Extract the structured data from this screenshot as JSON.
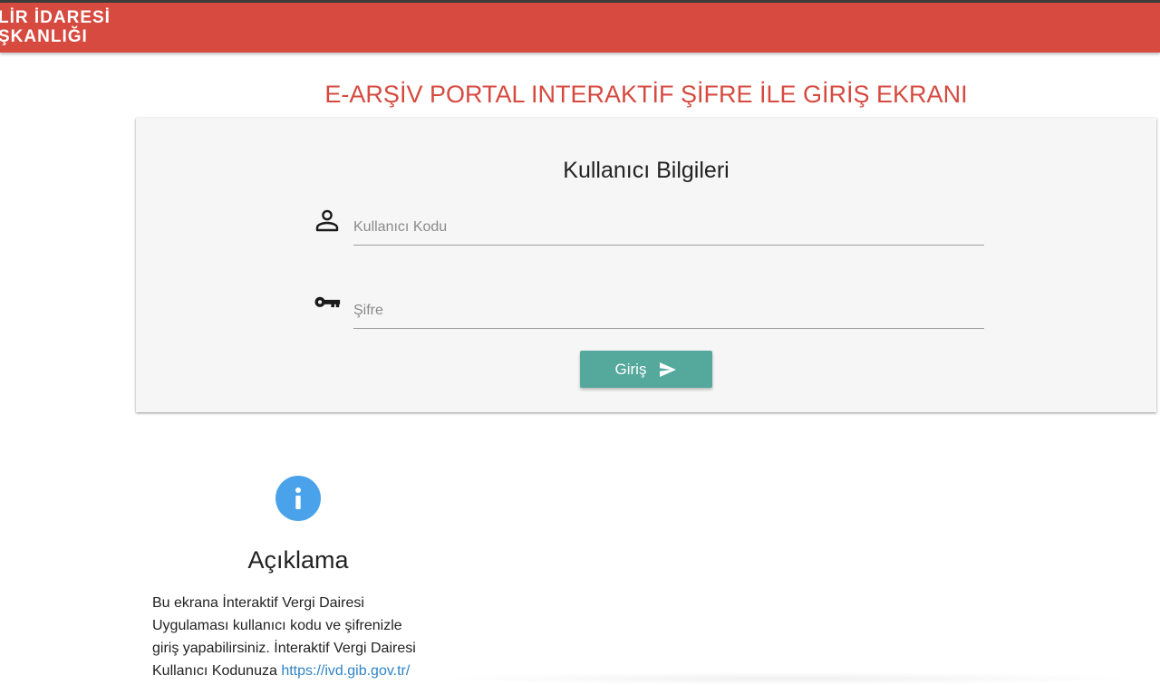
{
  "header": {
    "brand_line1": "LİR İDARESİ",
    "brand_line2": "ŞKANLIĞI",
    "bar_color": "#d64a40"
  },
  "page": {
    "title": "E-ARŞİV PORTAL INTERAKTİF ŞİFRE İLE GİRİŞ EKRANI"
  },
  "login": {
    "card_title": "Kullanıcı Bilgileri",
    "user_icon": "person-icon",
    "username_placeholder": "Kullanıcı Kodu",
    "username_value": "",
    "password_icon": "key-icon",
    "password_placeholder": "Şifre",
    "password_value": "",
    "submit_label": "Giriş",
    "submit_icon": "send-icon",
    "button_color": "#55a89c"
  },
  "info": {
    "icon": "info-icon",
    "icon_color": "#4aa3ea",
    "heading": "Açıklama",
    "line1": "Bu ekrana İnteraktif Vergi Dairesi",
    "line2": "Uygulaması kullanıcı kodu ve şifrenizle",
    "line3": "giriş yapabilirsiniz. İnteraktif Vergi Dairesi",
    "line4_text": "Kullanıcı Kodunuza ",
    "link_text": "https://ivd.gib.gov.tr/",
    "link_color": "#2f83c7"
  }
}
